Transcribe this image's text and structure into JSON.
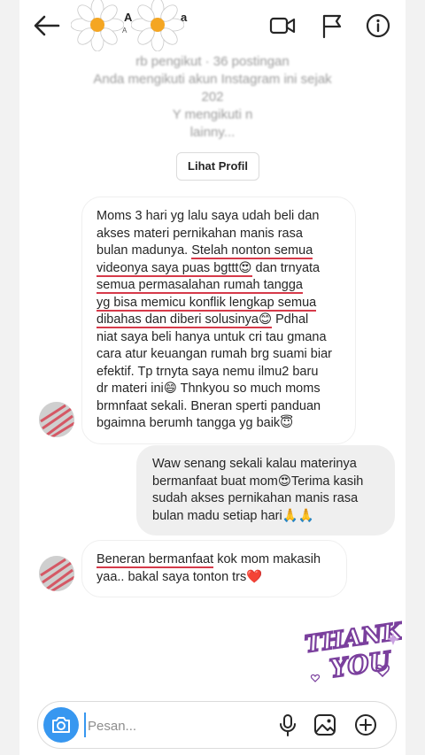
{
  "header": {
    "username_start": "A",
    "username_end": "a",
    "username_sub": "A",
    "icons": [
      "back-arrow-icon",
      "video-camera-icon",
      "flag-icon",
      "info-icon"
    ]
  },
  "profile_info": {
    "lines": [
      "rb pengikut · 36 postingan",
      "Anda mengikuti akun Instagram ini sejak",
      "202",
      "Y               mengikuti n               ",
      "lainny..."
    ],
    "button_label": "Lihat Profil"
  },
  "messages": [
    {
      "direction": "incoming",
      "lines": [
        {
          "text": "Moms 3 hari yg lalu saya udah beli dan",
          "underline": false
        },
        {
          "text": "akses materi pernikahan manis rasa",
          "underline": false
        },
        {
          "pre": "bulan madunya. ",
          "text": "Stelah nonton semua",
          "underline": true
        },
        {
          "text": "videonya saya puas bgttt😍",
          "post": " dan trnyata",
          "underline": true
        },
        {
          "text": "semua permasalahan rumah tangga",
          "underline": true
        },
        {
          "text": "yg bisa memicu konflik lengkap semua",
          "underline": true
        },
        {
          "text": "dibahas dan diberi solusinya😊",
          "post": " Pdhal",
          "underline": true
        },
        {
          "text": "niat saya beli hanya untuk cri tau gmana",
          "underline": false
        },
        {
          "text": "cara atur keuangan rumah brg suami biar",
          "underline": false
        },
        {
          "text": "efektif. Tp trnyta saya nemu ilmu2 baru",
          "underline": false
        },
        {
          "text": "dr materi ini😄 Thnkyou so much moms",
          "underline": false
        },
        {
          "text": "brmnfaat sekali. Bneran sperti panduan",
          "underline": false
        },
        {
          "text": "bgaimna berumh tangga yg baik😇",
          "underline": false
        }
      ]
    },
    {
      "direction": "outgoing",
      "lines": [
        {
          "text": "Waw senang sekali kalau materinya",
          "underline": false
        },
        {
          "text": "bermanfaat buat mom😍Terima kasih",
          "underline": false
        },
        {
          "text": "sudah akses pernikahan manis rasa",
          "underline": false
        },
        {
          "text": "bulan madu setiap hari🙏🙏",
          "underline": false
        }
      ]
    },
    {
      "direction": "incoming",
      "lines": [
        {
          "text": "Beneran bermanfaat",
          "post": " kok mom makasih",
          "underline": true
        },
        {
          "text": "yaa.. bakal saya tonton trs❤️",
          "underline": false
        }
      ]
    }
  ],
  "sticker": {
    "text_line1": "THANK",
    "text_line2": "YOU"
  },
  "composer": {
    "placeholder": "Pesan...",
    "value": "",
    "icons": [
      "camera-icon",
      "microphone-icon",
      "image-icon",
      "plus-circle-icon"
    ]
  },
  "colors": {
    "accent": "#3797f0",
    "underline": "#d63a4a",
    "outgoing_bubble": "#efefef",
    "sticker": "#7a3f9d"
  }
}
